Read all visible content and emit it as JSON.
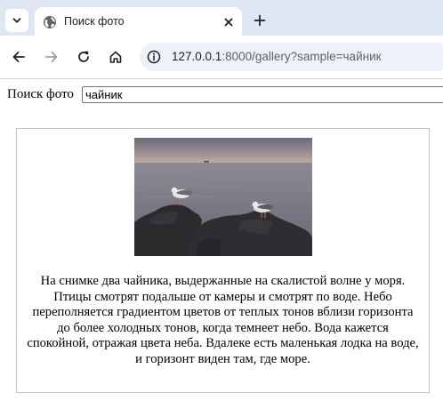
{
  "browser": {
    "tab": {
      "title": "Поиск фото",
      "favicon": "globe-icon"
    },
    "new_tab_icon": "plus-icon",
    "url_host": "127.0.0.1",
    "url_rest": ":8000/gallery?sample=чайник"
  },
  "page": {
    "search": {
      "label": "Поиск фото",
      "value": "чайник"
    },
    "result": {
      "image": "photo of two seagulls on a dark rocky outcrop by the sea at dusk",
      "caption": "На снимке два чайника, выдержанные на скалистой волне у моря. Птицы смотрят подальше от камеры и смотрят по воде. Небо переполняется градиентом цветов от теплых тонов вблизи горизонта до более холодных тонов, когда темнеет небо. Вода кажется спокойной, отражая цвета неба. Вдалеке есть маленькая лодка на воде, и горизонт виден там, где море."
    }
  },
  "colors": {
    "chrome_bg": "#dfe7f5",
    "omnibox_bg": "#edf1f8",
    "card_border": "#c4c4c4"
  }
}
